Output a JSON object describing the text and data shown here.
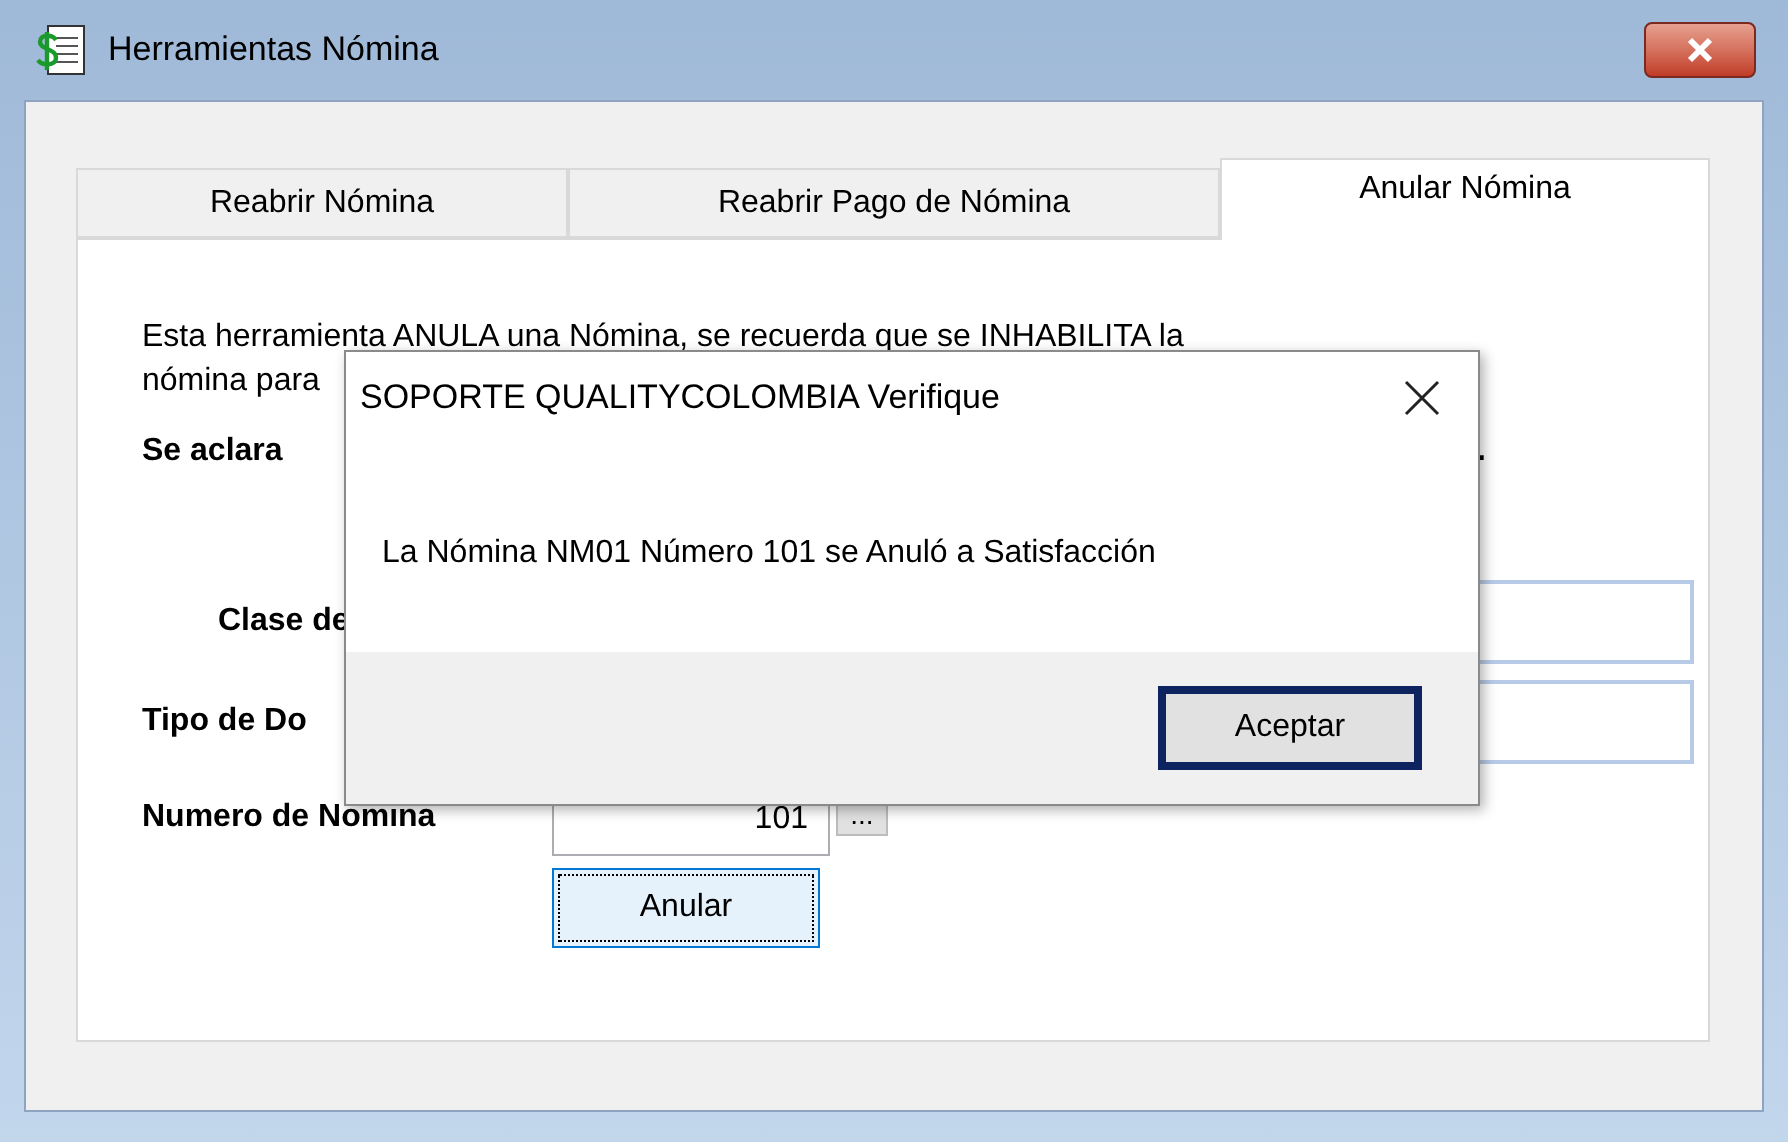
{
  "window": {
    "title": "Herramientas Nómina"
  },
  "tabs": [
    {
      "label": "Reabrir Nómina",
      "selected": false
    },
    {
      "label": "Reabrir Pago de Nómina",
      "selected": false
    },
    {
      "label": "Anular Nómina",
      "selected": true
    }
  ],
  "panel": {
    "description_lines": [
      "Esta herramienta ANULA una Nómina, se recuerda que se INHABILITA la",
      "nómina para"
    ],
    "note": "Se aclara",
    "note_tail": ".",
    "fields": [
      {
        "label": "Clase de",
        "kind": "text"
      },
      {
        "label": "Tipo de Do",
        "kind": "text"
      },
      {
        "label": "Numero de Nomina",
        "kind": "lookup",
        "value": "101",
        "lookup_label": "..."
      }
    ],
    "action": {
      "label": "Anular",
      "focused": true
    }
  },
  "dialog": {
    "title": "SOPORTE QUALITYCOLOMBIA Verifique",
    "message": "La Nómina NM01 Número 101 se Anuló a Satisfacción",
    "buttons": [
      {
        "label": "Aceptar",
        "focused": true
      }
    ]
  }
}
